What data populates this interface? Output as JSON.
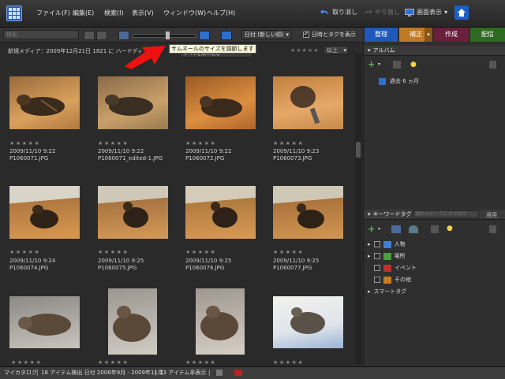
{
  "menu": {
    "items": [
      "ファイル(F)",
      "編集(E)",
      "検索(I)",
      "表示(V)",
      "ウィンドウ(W)",
      "ヘルプ(H)"
    ],
    "undo_label": "取り消し",
    "redo_label": "やり直し",
    "display_label": "画面表示"
  },
  "toolbar": {
    "search_placeholder": "検索",
    "sort_value": "日付 (新しい順)",
    "show_datetime_label": "日時とタグを表示"
  },
  "tabs": [
    {
      "label": "整理",
      "color": "#1f58b8"
    },
    {
      "label": "補正",
      "color": "#c07a24"
    },
    {
      "label": "作成",
      "color": "#6a1f3b"
    },
    {
      "label": "配信",
      "color": "#2f6a22"
    }
  ],
  "grid": {
    "info_text": "新規メディア：2009年12月21日 1821 に ハードディ",
    "info_suffix": "込み",
    "tooltip": "サムネールのサイズを調節します",
    "sort_behind": "すべてを読み込む",
    "rating_filter": "以上",
    "items": [
      {
        "date": "2009/11/10 9:22",
        "file": "P1060071.JPG"
      },
      {
        "date": "2009/11/10 9:22",
        "file": "P1060071_edited-1.JPG"
      },
      {
        "date": "2009/11/10 9:22",
        "file": "P1060072.JPG"
      },
      {
        "date": "2009/11/10 9:23",
        "file": "P1060073.JPG"
      },
      {
        "date": "2009/11/10 9:24",
        "file": "P1060074.JPG"
      },
      {
        "date": "2009/11/10 9:25",
        "file": "P1060075.JPG"
      },
      {
        "date": "2009/11/10 9:25",
        "file": "P1060076.JPG"
      },
      {
        "date": "2009/11/10 9:25",
        "file": "P1060077.JPG"
      }
    ]
  },
  "albums": {
    "header": "アルバム",
    "items": [
      "過去 6 ヵ月"
    ]
  },
  "keywords": {
    "header": "キーワードタグ",
    "search_placeholder": "選択メディアにタグ付け",
    "apply_label": "適用",
    "items": [
      {
        "label": "人物",
        "color": "#3f7fd0"
      },
      {
        "label": "場所",
        "color": "#4aa03c"
      },
      {
        "label": "イベント",
        "color": "#c0302c"
      },
      {
        "label": "その他",
        "color": "#c77d22"
      }
    ],
    "smart_tags": "スマートタグ"
  },
  "status": {
    "catalog": "マイカタログ",
    "found": "18 アイテム検出 日付 2006年9月 - 2009年11月",
    "hidden": "13 アイテム非表示"
  }
}
